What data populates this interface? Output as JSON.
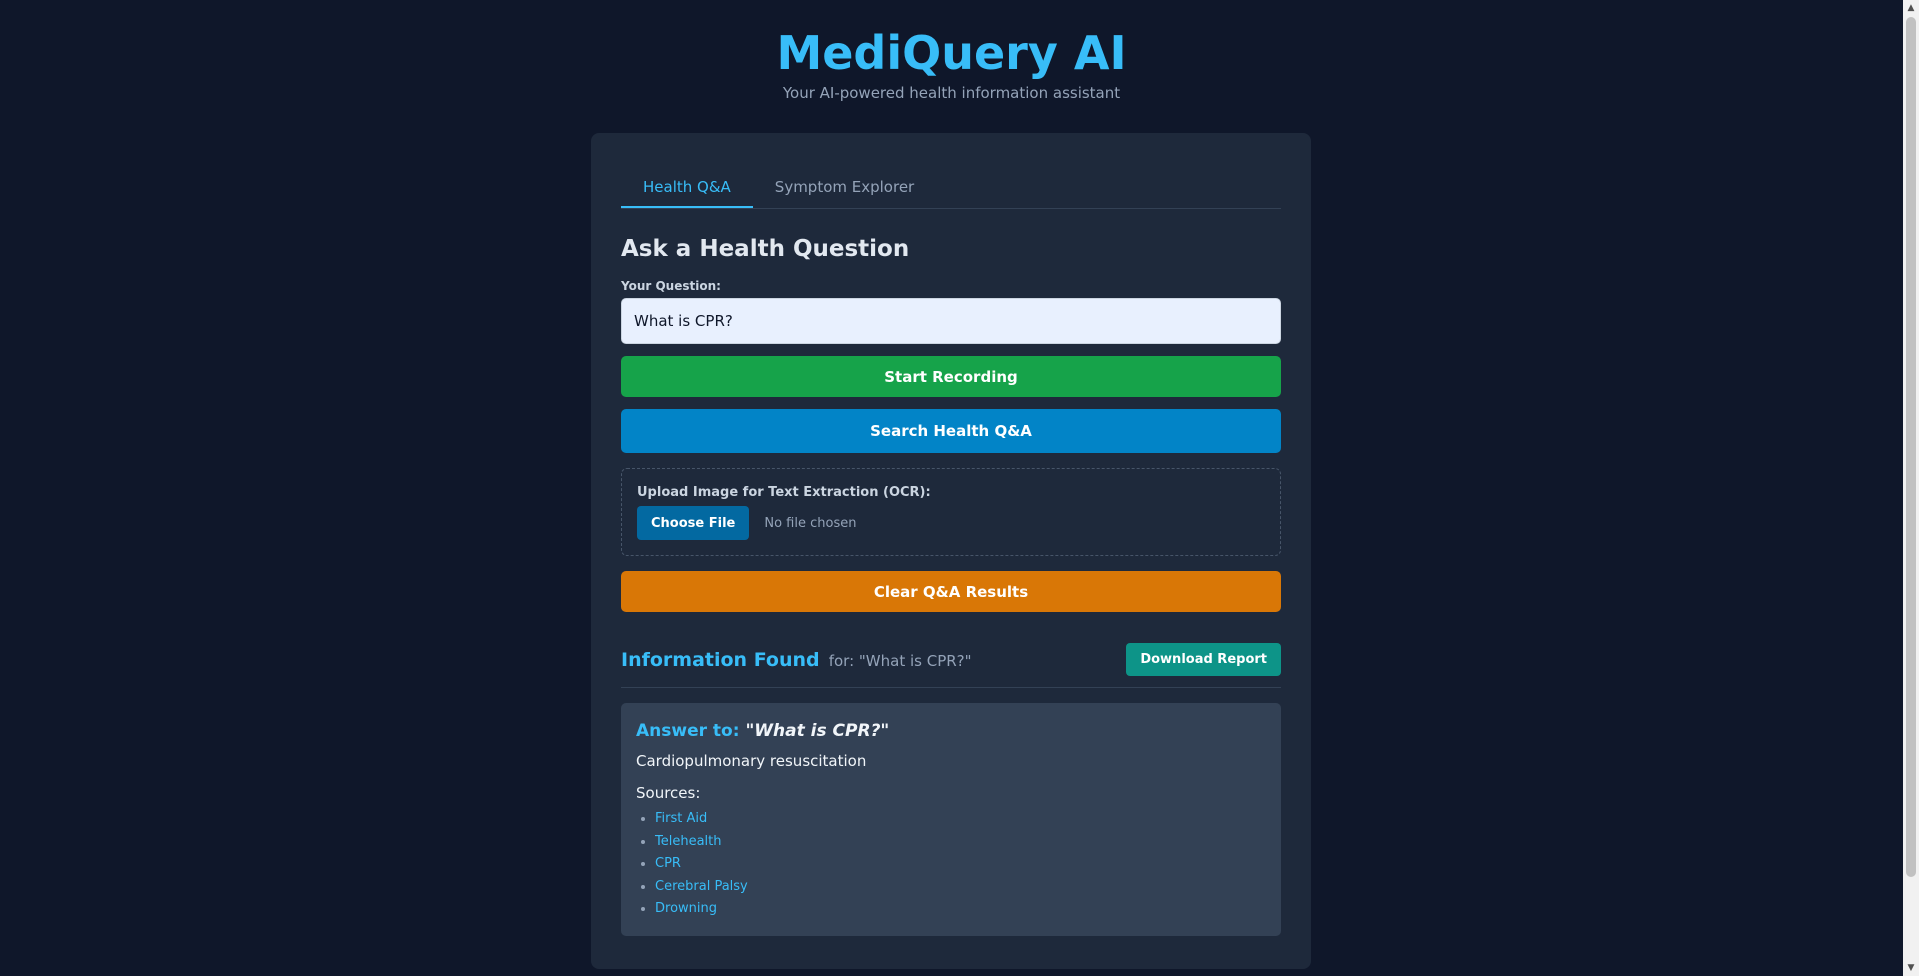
{
  "header": {
    "title": "MediQuery AI",
    "subtitle": "Your AI-powered health information assistant"
  },
  "tabs": [
    {
      "label": "Health Q&A",
      "active": true
    },
    {
      "label": "Symptom Explorer",
      "active": false
    }
  ],
  "qa": {
    "section_title": "Ask a Health Question",
    "question_label": "Your Question:",
    "question_value": "What is CPR?",
    "record_button": "Start Recording",
    "search_button": "Search Health Q&A",
    "upload_label": "Upload Image for Text Extraction (OCR):",
    "choose_file_button": "Choose File",
    "file_status": "No file chosen",
    "clear_button": "Clear Q&A Results"
  },
  "results": {
    "title": "Information Found",
    "query_suffix": "for: \"What is CPR?\"",
    "download_button": "Download Report",
    "answer_prefix": "Answer to:",
    "answer_question": "\"What is CPR?\"",
    "answer_text": "Cardiopulmonary resuscitation",
    "sources_label": "Sources:",
    "sources": [
      "First Aid",
      "Telehealth",
      "CPR",
      "Cerebral Palsy",
      "Drowning"
    ]
  },
  "colors": {
    "background": "#0f172a",
    "card": "#1e293b",
    "accent": "#38bdf8",
    "record": "#16a34a",
    "search": "#0284c7",
    "clear": "#d97706",
    "download": "#0d9488"
  }
}
